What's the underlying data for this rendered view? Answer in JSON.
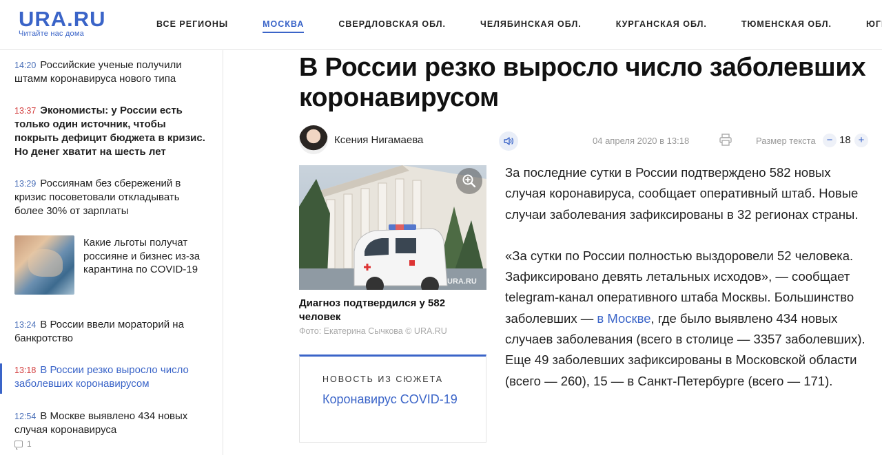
{
  "header": {
    "logo": "URA.RU",
    "tagline": "Читайте нас дома",
    "nav": [
      "ВСЕ РЕГИОНЫ",
      "МОСКВА",
      "СВЕРДЛОВСКАЯ ОБЛ.",
      "ЧЕЛЯБИНСКАЯ ОБЛ.",
      "КУРГАНСКАЯ ОБЛ.",
      "ТЮМЕНСКАЯ ОБЛ.",
      "ЮГРА"
    ],
    "active_nav": "МОСКВА"
  },
  "sidebar": {
    "items": [
      {
        "time": "14:20",
        "title": "Российские ученые получили штамм коронавируса нового типа"
      },
      {
        "time": "13:37",
        "title": "Экономисты: у России есть только один источник, чтобы покрыть дефицит бюджета в кризис. Но денег хватит на шесть лет"
      },
      {
        "time": "13:29",
        "title": "Россиянам без сбережений в кризис посоветовали откладывать более 30% от зарплаты"
      },
      {
        "time": "",
        "title": "Какие льготы получат россияне и бизнес из-за карантина по COVID-19"
      },
      {
        "time": "13:24",
        "title": "В России ввели мораторий на банкротство"
      },
      {
        "time": "13:18",
        "title": "В России резко выросло число заболевших коронавирусом"
      },
      {
        "time": "12:54",
        "title": "В Москве выявлено 434 новых случая коронавируса"
      }
    ],
    "comments_count": "1"
  },
  "article": {
    "headline": "В России резко выросло число заболевших коронавирусом",
    "author": "Ксения Нигамаева",
    "date": "04 апреля 2020 в 13:18",
    "font_size_label": "Размер текста",
    "font_size": "18",
    "font_minus": "−",
    "font_plus": "+",
    "photo_caption": "Диагноз подтвердился у 582 человек",
    "photo_credit": "Фото: Екатерина Сычкова © URA.RU",
    "photo_watermark": "URA.RU",
    "story_label": "НОВОСТЬ ИЗ СЮЖЕТА",
    "story_link": "Коронавирус COVID-19",
    "p1": "За последние сутки в России подтверждено 582 новых случая коронавируса, сообщает оперативный штаб. Новые случаи заболевания зафиксированы в 32 регионах страны.",
    "p2_a": "«За сутки по России полностью выздоровели 52 человека. Зафиксировано девять летальных исходов», — сообщает telegram-канал оперативного штаба Москвы. Большинство заболевших — ",
    "p2_link": "в Москве",
    "p2_b": ", где было выявлено 434 новых случаев заболевания (всего в столице — 3357 заболевших). Еще 49 заболевших зафиксированы в Московской области (всего — 260), 15 — в Санкт-Петербурге (всего — 171)."
  },
  "colors": {
    "accent": "#3a64c8",
    "time_red": "#d23c3c"
  }
}
